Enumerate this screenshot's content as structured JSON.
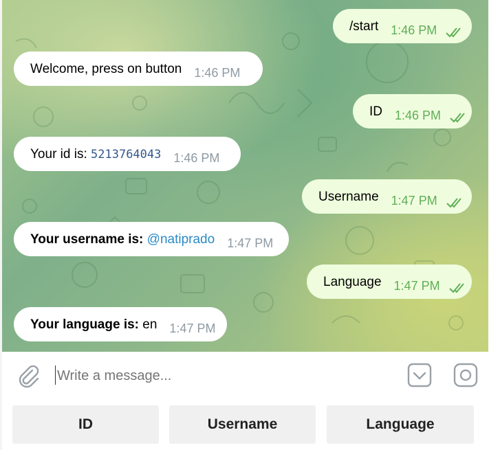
{
  "messages": {
    "m1": {
      "text": "/start",
      "time": "1:46 PM"
    },
    "m2": {
      "text": "Welcome, press on button",
      "time": "1:46 PM"
    },
    "m3": {
      "text": "ID",
      "time": "1:46 PM"
    },
    "m4": {
      "prefix": "Your id is: ",
      "value": "5213764043",
      "time": "1:46 PM"
    },
    "m5": {
      "text": "Username",
      "time": "1:47 PM"
    },
    "m6": {
      "prefix": "Your username is: ",
      "value": "@natiprado",
      "time": "1:47 PM"
    },
    "m7": {
      "text": "Language",
      "time": "1:47 PM"
    },
    "m8": {
      "prefix": "Your language is: ",
      "value": "en",
      "time": "1:47 PM"
    }
  },
  "composer": {
    "placeholder": "Write a message...",
    "icons": [
      "paperclip-icon",
      "keyboard-toggle-icon",
      "camera-icon"
    ]
  },
  "reply_keyboard": {
    "buttons": [
      "ID",
      "Username",
      "Language"
    ]
  },
  "colors": {
    "outgoing_bubble": "#effdde",
    "incoming_bubble": "#ffffff",
    "outgoing_time": "#5fae57",
    "link": "#2a8ac6"
  }
}
